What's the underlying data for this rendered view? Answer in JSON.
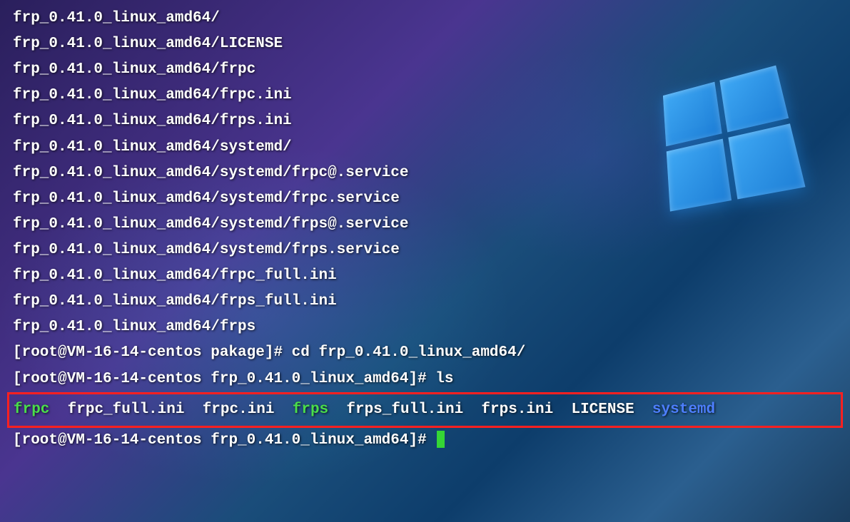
{
  "extracted_files": [
    "frp_0.41.0_linux_amd64/",
    "frp_0.41.0_linux_amd64/LICENSE",
    "frp_0.41.0_linux_amd64/frpc",
    "frp_0.41.0_linux_amd64/frpc.ini",
    "frp_0.41.0_linux_amd64/frps.ini",
    "frp_0.41.0_linux_amd64/systemd/",
    "frp_0.41.0_linux_amd64/systemd/frpc@.service",
    "frp_0.41.0_linux_amd64/systemd/frpc.service",
    "frp_0.41.0_linux_amd64/systemd/frps@.service",
    "frp_0.41.0_linux_amd64/systemd/frps.service",
    "frp_0.41.0_linux_amd64/frpc_full.ini",
    "frp_0.41.0_linux_amd64/frps_full.ini",
    "frp_0.41.0_linux_amd64/frps"
  ],
  "prompt1": {
    "prefix": "[root@VM-16-14-centos pakage]# ",
    "command": "cd frp_0.41.0_linux_amd64/"
  },
  "prompt2": {
    "prefix": "[root@VM-16-14-centos frp_0.41.0_linux_amd64]# ",
    "command": "ls"
  },
  "ls_output": [
    {
      "name": "frpc",
      "color": "green"
    },
    {
      "name": "frpc_full.ini",
      "color": "white"
    },
    {
      "name": "frpc.ini",
      "color": "white"
    },
    {
      "name": "frps",
      "color": "green"
    },
    {
      "name": "frps_full.ini",
      "color": "white"
    },
    {
      "name": "frps.ini",
      "color": "white"
    },
    {
      "name": "LICENSE",
      "color": "white"
    },
    {
      "name": "systemd",
      "color": "blue"
    }
  ],
  "prompt3": {
    "prefix": "[root@VM-16-14-centos frp_0.41.0_linux_amd64]# "
  },
  "colors": {
    "text_white": "#ffffff",
    "text_green": "#4ade4a",
    "text_blue": "#4d7fff",
    "highlight_border": "#ff2020",
    "cursor": "#35d635"
  }
}
